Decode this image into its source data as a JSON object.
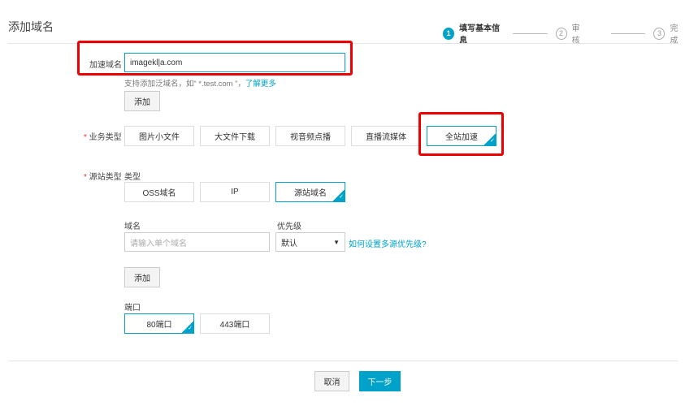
{
  "header": {
    "title": "添加域名",
    "steps": [
      {
        "num": "1",
        "label": "填写基本信息"
      },
      {
        "num": "2",
        "label": "审核"
      },
      {
        "num": "3",
        "label": "完成"
      }
    ]
  },
  "domain": {
    "label": "加速域名",
    "value": "imagekl|a.com",
    "hint": "支持添加泛域名，如“ *.test.com ”，",
    "hint_link": "了解更多",
    "add": "添加"
  },
  "business": {
    "label": "业务类型",
    "options": [
      "图片小文件",
      "大文件下载",
      "视音频点播",
      "直播流媒体",
      "全站加速"
    ],
    "selected": "全站加速"
  },
  "origin": {
    "label": "源站类型",
    "type_label": "类型",
    "types": [
      "OSS域名",
      "IP",
      "源站域名"
    ],
    "selected": "源站域名",
    "domain_label": "域名",
    "domain_placeholder": "请输入单个域名",
    "priority_label": "优先级",
    "priority_value": "默认",
    "priority_link": "如何设置多源优先级?",
    "add": "添加",
    "port_label": "端口",
    "ports": [
      "80端口",
      "443端口"
    ],
    "port_selected": "80端口"
  },
  "footer": {
    "cancel": "取消",
    "next": "下一步"
  },
  "colors": {
    "accent": "#00a2ca",
    "highlight": "#e00000"
  }
}
